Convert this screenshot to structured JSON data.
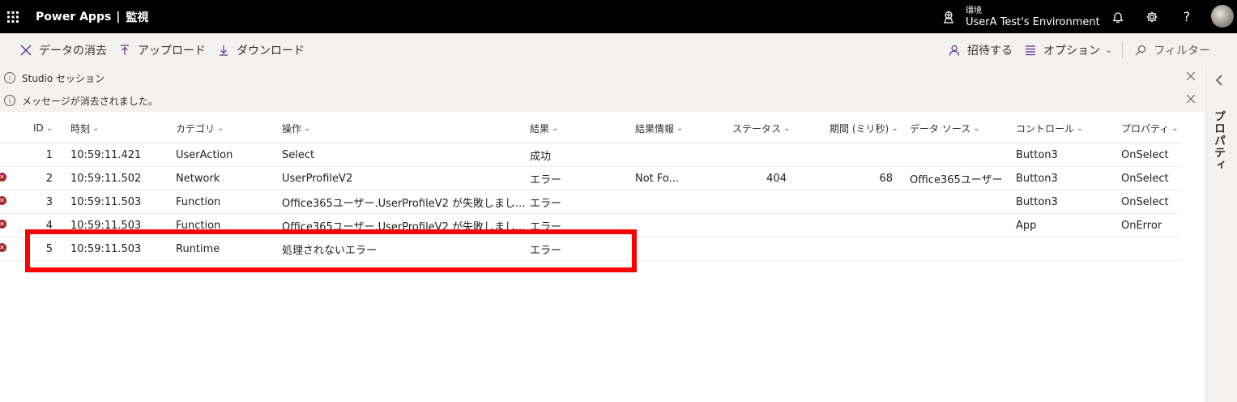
{
  "header": {
    "app_name": "Power Apps",
    "separator": "|",
    "page_name": "監視",
    "environment_label": "環境",
    "environment_name": "UserA Test's Environment"
  },
  "command_bar": {
    "clear_data": "データの消去",
    "upload": "アップロード",
    "download": "ダウンロード",
    "invite": "招待する",
    "options": "オプション",
    "filter": "フィルター"
  },
  "messages": [
    {
      "text": "Studio セッション"
    },
    {
      "text": "メッセージが消去されました。"
    }
  ],
  "right_panel": {
    "label": "プロパティ"
  },
  "table": {
    "columns": [
      "ID",
      "時刻",
      "カテゴリ",
      "操作",
      "結果",
      "結果情報",
      "ステータス",
      "期間 (ミリ秒)",
      "データ ソース",
      "コントロール",
      "プロパティ"
    ],
    "rows": [
      {
        "error": false,
        "id": "1",
        "time": "10:59:11.421",
        "category": "UserAction",
        "operation": "Select",
        "result": "成功",
        "result_info": "",
        "status": "",
        "duration": "",
        "data_source": "",
        "control": "Button3",
        "property": "OnSelect"
      },
      {
        "error": true,
        "id": "2",
        "time": "10:59:11.502",
        "category": "Network",
        "operation": "UserProfileV2",
        "result": "エラー",
        "result_info": "Not Fo...",
        "status": "404",
        "duration": "68",
        "data_source": "Office365ユーザー",
        "control": "Button3",
        "property": "OnSelect"
      },
      {
        "error": true,
        "id": "3",
        "time": "10:59:11.503",
        "category": "Function",
        "operation": "Office365ユーザー.UserProfileV2 が失敗しまし...",
        "result": "エラー",
        "result_info": "",
        "status": "",
        "duration": "",
        "data_source": "",
        "control": "Button3",
        "property": "OnSelect"
      },
      {
        "error": true,
        "id": "4",
        "time": "10:59:11.503",
        "category": "Function",
        "operation": "Office365ユーザー.UserProfileV2 が失敗しまし...",
        "result": "エラー",
        "result_info": "",
        "status": "",
        "duration": "",
        "data_source": "",
        "control": "App",
        "property": "OnError"
      },
      {
        "error": true,
        "id": "5",
        "time": "10:59:11.503",
        "category": "Runtime",
        "operation": "処理されないエラー",
        "result": "エラー",
        "result_info": "",
        "status": "",
        "duration": "",
        "data_source": "",
        "control": "",
        "property": ""
      }
    ]
  },
  "colors": {
    "header_bg": "#000000",
    "command_bg": "#f3f2f1",
    "error_red": "#a4262c",
    "highlight_red": "#ff0000",
    "accent_purple": "#5c2d91"
  }
}
